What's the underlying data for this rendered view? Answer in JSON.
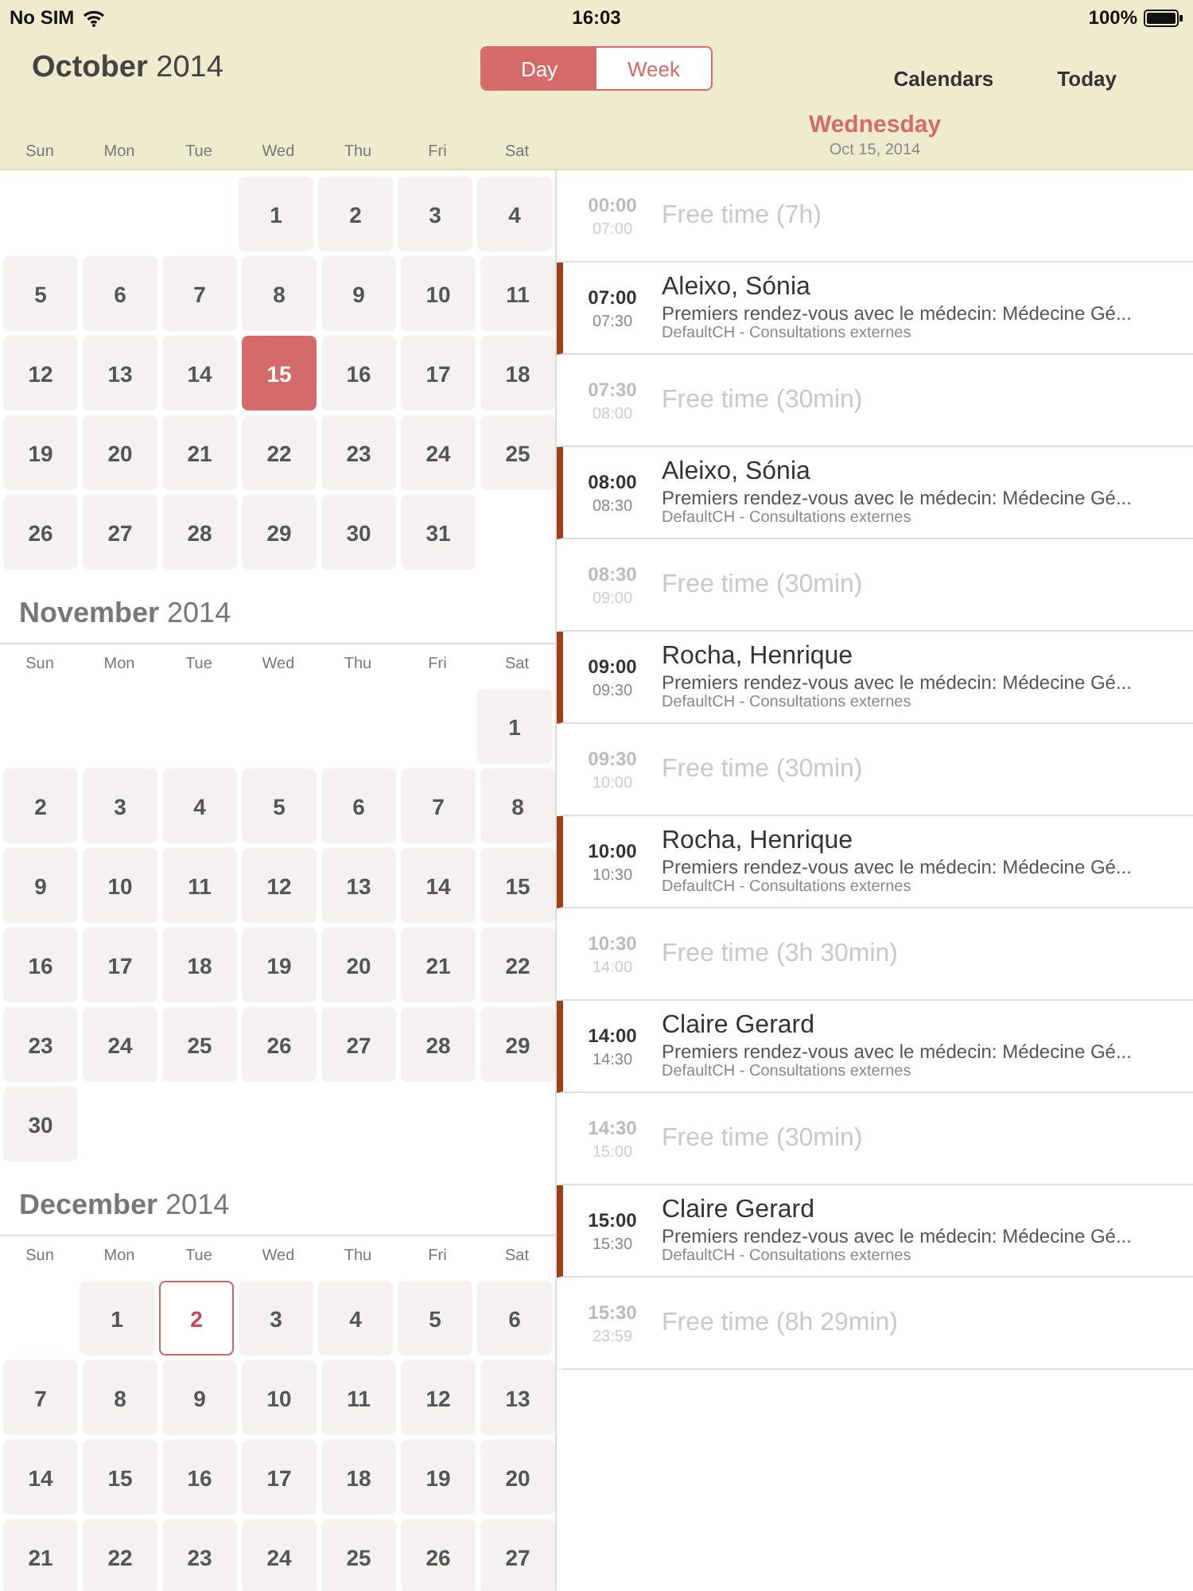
{
  "status_bar": {
    "carrier": "No SIM",
    "time": "16:03",
    "battery": "100%"
  },
  "toolbar": {
    "title": "**October** 2014",
    "segments": [
      {
        "label": "Day",
        "selected": true
      },
      {
        "label": "Week",
        "selected": false
      }
    ],
    "buttons": [
      "Calendars",
      "Today"
    ]
  },
  "weekdays": [
    "Sun",
    "Mon",
    "Tue",
    "Wed",
    "Thu",
    "Fri",
    "Sat"
  ],
  "day_heading": {
    "weekday": "Wednesday",
    "date": "Oct 15, 2014"
  },
  "months": [
    {
      "weeks": [
        {
          "kind": "first",
          "days": [
            {
              "label": "1",
              "selected": false,
              "today": false
            },
            {
              "label": "2",
              "selected": false,
              "today": false
            },
            {
              "label": "3",
              "selected": false,
              "today": false
            },
            {
              "label": "4",
              "selected": false,
              "today": false
            }
          ]
        },
        {
          "kind": "middle",
          "days": [
            {
              "label": "5",
              "selected": false,
              "today": false
            },
            {
              "label": "6",
              "selected": false,
              "today": false
            },
            {
              "label": "7",
              "selected": false,
              "today": false
            },
            {
              "label": "8",
              "selected": false,
              "today": false
            },
            {
              "label": "9",
              "selected": false,
              "today": false
            },
            {
              "label": "10",
              "selected": false,
              "today": false
            },
            {
              "label": "11",
              "selected": false,
              "today": false
            }
          ]
        },
        {
          "kind": "middle",
          "days": [
            {
              "label": "12",
              "selected": false,
              "today": false
            },
            {
              "label": "13",
              "selected": false,
              "today": false
            },
            {
              "label": "14",
              "selected": false,
              "today": false
            },
            {
              "label": "15",
              "selected": true,
              "today": false
            },
            {
              "label": "16",
              "selected": false,
              "today": false
            },
            {
              "label": "17",
              "selected": false,
              "today": false
            },
            {
              "label": "18",
              "selected": false,
              "today": false
            }
          ]
        },
        {
          "kind": "middle",
          "days": [
            {
              "label": "19",
              "selected": false,
              "today": false
            },
            {
              "label": "20",
              "selected": false,
              "today": false
            },
            {
              "label": "21",
              "selected": false,
              "today": false
            },
            {
              "label": "22",
              "selected": false,
              "today": false
            },
            {
              "label": "23",
              "selected": false,
              "today": false
            },
            {
              "label": "24",
              "selected": false,
              "today": false
            },
            {
              "label": "25",
              "selected": false,
              "today": false
            }
          ]
        },
        {
          "kind": "last",
          "days": [
            {
              "label": "26",
              "selected": false,
              "today": false
            },
            {
              "label": "27",
              "selected": false,
              "today": false
            },
            {
              "label": "28",
              "selected": false,
              "today": false
            },
            {
              "label": "29",
              "selected": false,
              "today": false
            },
            {
              "label": "30",
              "selected": false,
              "today": false
            },
            {
              "label": "31",
              "selected": false,
              "today": false
            }
          ]
        }
      ]
    },
    {
      "title": "**November** 2014",
      "weekdays": [
        "Sun",
        "Mon",
        "Tue",
        "Wed",
        "Thu",
        "Fri",
        "Sat"
      ],
      "weeks": [
        {
          "kind": "first",
          "days": [
            {
              "label": "1",
              "selected": false,
              "today": false
            }
          ]
        },
        {
          "kind": "middle",
          "days": [
            {
              "label": "2",
              "selected": false,
              "today": false
            },
            {
              "label": "3",
              "selected": false,
              "today": false
            },
            {
              "label": "4",
              "selected": false,
              "today": false
            },
            {
              "label": "5",
              "selected": false,
              "today": false
            },
            {
              "label": "6",
              "selected": false,
              "today": false
            },
            {
              "label": "7",
              "selected": false,
              "today": false
            },
            {
              "label": "8",
              "selected": false,
              "today": false
            }
          ]
        },
        {
          "kind": "middle",
          "days": [
            {
              "label": "9",
              "selected": false,
              "today": false
            },
            {
              "label": "10",
              "selected": false,
              "today": false
            },
            {
              "label": "11",
              "selected": false,
              "today": false
            },
            {
              "label": "12",
              "selected": false,
              "today": false
            },
            {
              "label": "13",
              "selected": false,
              "today": false
            },
            {
              "label": "14",
              "selected": false,
              "today": false
            },
            {
              "label": "15",
              "selected": false,
              "today": false
            }
          ]
        },
        {
          "kind": "middle",
          "days": [
            {
              "label": "16",
              "selected": false,
              "today": false
            },
            {
              "label": "17",
              "selected": false,
              "today": false
            },
            {
              "label": "18",
              "selected": false,
              "today": false
            },
            {
              "label": "19",
              "selected": false,
              "today": false
            },
            {
              "label": "20",
              "selected": false,
              "today": false
            },
            {
              "label": "21",
              "selected": false,
              "today": false
            },
            {
              "label": "22",
              "selected": false,
              "today": false
            }
          ]
        },
        {
          "kind": "middle",
          "days": [
            {
              "label": "23",
              "selected": false,
              "today": false
            },
            {
              "label": "24",
              "selected": false,
              "today": false
            },
            {
              "label": "25",
              "selected": false,
              "today": false
            },
            {
              "label": "26",
              "selected": false,
              "today": false
            },
            {
              "label": "27",
              "selected": false,
              "today": false
            },
            {
              "label": "28",
              "selected": false,
              "today": false
            },
            {
              "label": "29",
              "selected": false,
              "today": false
            }
          ]
        },
        {
          "kind": "last",
          "days": [
            {
              "label": "30",
              "selected": false,
              "today": false
            }
          ]
        }
      ]
    },
    {
      "title": "**December** 2014",
      "weekdays": [
        "Sun",
        "Mon",
        "Tue",
        "Wed",
        "Thu",
        "Fri",
        "Sat"
      ],
      "weeks": [
        {
          "kind": "first",
          "days": [
            {
              "label": "1",
              "selected": false,
              "today": false
            },
            {
              "label": "2",
              "selected": false,
              "today": true
            },
            {
              "label": "3",
              "selected": false,
              "today": false
            },
            {
              "label": "4",
              "selected": false,
              "today": false
            },
            {
              "label": "5",
              "selected": false,
              "today": false
            },
            {
              "label": "6",
              "selected": false,
              "today": false
            }
          ]
        },
        {
          "kind": "middle",
          "days": [
            {
              "label": "7",
              "selected": false,
              "today": false
            },
            {
              "label": "8",
              "selected": false,
              "today": false
            },
            {
              "label": "9",
              "selected": false,
              "today": false
            },
            {
              "label": "10",
              "selected": false,
              "today": false
            },
            {
              "label": "11",
              "selected": false,
              "today": false
            },
            {
              "label": "12",
              "selected": false,
              "today": false
            },
            {
              "label": "13",
              "selected": false,
              "today": false
            }
          ]
        },
        {
          "kind": "middle",
          "days": [
            {
              "label": "14",
              "selected": false,
              "today": false
            },
            {
              "label": "15",
              "selected": false,
              "today": false
            },
            {
              "label": "16",
              "selected": false,
              "today": false
            },
            {
              "label": "17",
              "selected": false,
              "today": false
            },
            {
              "label": "18",
              "selected": false,
              "today": false
            },
            {
              "label": "19",
              "selected": false,
              "today": false
            },
            {
              "label": "20",
              "selected": false,
              "today": false
            }
          ]
        },
        {
          "kind": "last",
          "days": [
            {
              "label": "21",
              "selected": false,
              "today": false
            },
            {
              "label": "22",
              "selected": false,
              "today": false
            },
            {
              "label": "23",
              "selected": false,
              "today": false
            },
            {
              "label": "24",
              "selected": false,
              "today": false
            },
            {
              "label": "25",
              "selected": false,
              "today": false
            },
            {
              "label": "26",
              "selected": false,
              "today": false
            },
            {
              "label": "27",
              "selected": false,
              "today": false
            }
          ]
        }
      ]
    }
  ],
  "events": [
    {
      "kind": "free",
      "start": "00:00",
      "end": "07:00",
      "title": "Free time (7h)"
    },
    {
      "kind": "appointment",
      "start": "07:00",
      "end": "07:30",
      "title": "Aleixo, Sónia",
      "description": "Premiers rendez-vous avec le médecin: Médecine Gé...",
      "location": "DefaultCH - Consultations externes"
    },
    {
      "kind": "free",
      "start": "07:30",
      "end": "08:00",
      "title": "Free time (30min)"
    },
    {
      "kind": "appointment",
      "start": "08:00",
      "end": "08:30",
      "title": "Aleixo, Sónia",
      "description": "Premiers rendez-vous avec le médecin: Médecine Gé...",
      "location": "DefaultCH - Consultations externes"
    },
    {
      "kind": "free",
      "start": "08:30",
      "end": "09:00",
      "title": "Free time (30min)"
    },
    {
      "kind": "appointment",
      "start": "09:00",
      "end": "09:30",
      "title": "Rocha, Henrique",
      "description": "Premiers rendez-vous avec le médecin: Médecine Gé...",
      "location": "DefaultCH - Consultations externes"
    },
    {
      "kind": "free",
      "start": "09:30",
      "end": "10:00",
      "title": "Free time (30min)"
    },
    {
      "kind": "appointment",
      "start": "10:00",
      "end": "10:30",
      "title": "Rocha, Henrique",
      "description": "Premiers rendez-vous avec le médecin: Médecine Gé...",
      "location": "DefaultCH - Consultations externes"
    },
    {
      "kind": "free",
      "start": "10:30",
      "end": "14:00",
      "title": "Free time (3h 30min)"
    },
    {
      "kind": "appointment",
      "start": "14:00",
      "end": "14:30",
      "title": "Claire  Gerard",
      "description": "Premiers rendez-vous avec le médecin: Médecine Gé...",
      "location": "DefaultCH - Consultations externes"
    },
    {
      "kind": "free",
      "start": "14:30",
      "end": "15:00",
      "title": "Free time (30min)"
    },
    {
      "kind": "appointment",
      "start": "15:00",
      "end": "15:30",
      "title": "Claire  Gerard",
      "description": "Premiers rendez-vous avec le médecin: Médecine Gé...",
      "location": "DefaultCH - Consultations externes"
    },
    {
      "kind": "free",
      "start": "15:30",
      "end": "23:59",
      "title": "Free time (8h 29min)"
    }
  ]
}
